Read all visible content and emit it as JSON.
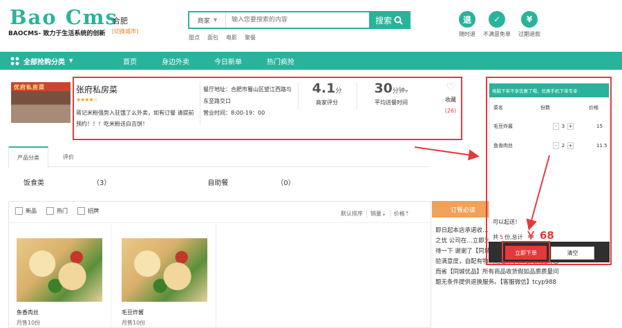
{
  "header": {
    "logo": "Bao Cms",
    "slogan": "BAOCMS- 致力于生活系统的创新",
    "city": "合肥",
    "city_switch": "[切换城市]",
    "search": {
      "category": "商家",
      "placeholder": "输入您要搜索的内容",
      "button": "搜索"
    },
    "hot_words": [
      "甜点",
      "面包",
      "电影",
      "聚餐"
    ],
    "services": [
      {
        "glyph": "退",
        "label": "随时退"
      },
      {
        "glyph": "✓",
        "label": "不满意免单"
      },
      {
        "glyph": "¥",
        "label": "过期退款"
      }
    ]
  },
  "nav": {
    "all_categories": "全部抢购分类",
    "items": [
      "首页",
      "身边外卖",
      "今日新单",
      "热门疯抢"
    ]
  },
  "shop": {
    "sign": "优府私房菜",
    "name": "张府私房菜",
    "stars": "★★★★☆",
    "rating": 4,
    "description": "蒋记米粉强势入驻饿了么外卖，如有订餐 请提前预约！！！吃米粉送白吉饼！",
    "address_label": "餐厅地址：",
    "address": "合肥市蜀山区望江西路与东至路交口",
    "hours_label": "营业时间：",
    "hours": "8:00-19：00",
    "score_value": "4.1",
    "score_unit": "分",
    "score_label": "商家评分",
    "delivery_value": "30",
    "delivery_unit": "分钟",
    "delivery_label": "平均送餐时间",
    "fav_label": "收藏",
    "fav_count": "(26)"
  },
  "tabs": [
    "产品分类",
    "评价"
  ],
  "categories": [
    {
      "name": "饭食类",
      "count": "（3）"
    },
    {
      "name": "自助餐",
      "count": "（0）"
    }
  ],
  "filters": [
    "新品",
    "热门",
    "招牌"
  ],
  "sorts": [
    "默认排序",
    "销量⇣",
    "价格⇡"
  ],
  "products": [
    {
      "name": "鱼香肉丝",
      "sold": "月售10份"
    },
    {
      "name": "毛豆炸酱",
      "sold": "月售10份"
    }
  ],
  "notice": {
    "title": "订餐必读",
    "body": "即日起本店承诺收…何质量问题我们包…幼后顾之忧 公司在…立即为您处理配送…烦您耐心等待一下 谢谢了【同城优品】专注于提升客户体验满意度，自配有物流配送体系，时间由此为您而省【同城优品】所有商品收货假如品质质量问题无条件提供退换服务。【客服微信】tcyp988"
  },
  "cart": {
    "banner": "电脑下单不享优惠了哦，优惠手机下单专享",
    "col_name": "菜名",
    "col_qty": "份数",
    "col_price": "价格",
    "items": [
      {
        "name": "毛豆炸酱",
        "qty": "3",
        "price": "15"
      },
      {
        "name": "鱼香肉丝",
        "qty": "2",
        "price": "11.5"
      }
    ],
    "ok_message": "可以起送！",
    "total_prefix": "共",
    "total_count": "5",
    "total_mid": "份,总计",
    "total_amount": "￥ 68",
    "order_button": "立即下单",
    "clear_button": "清空"
  }
}
